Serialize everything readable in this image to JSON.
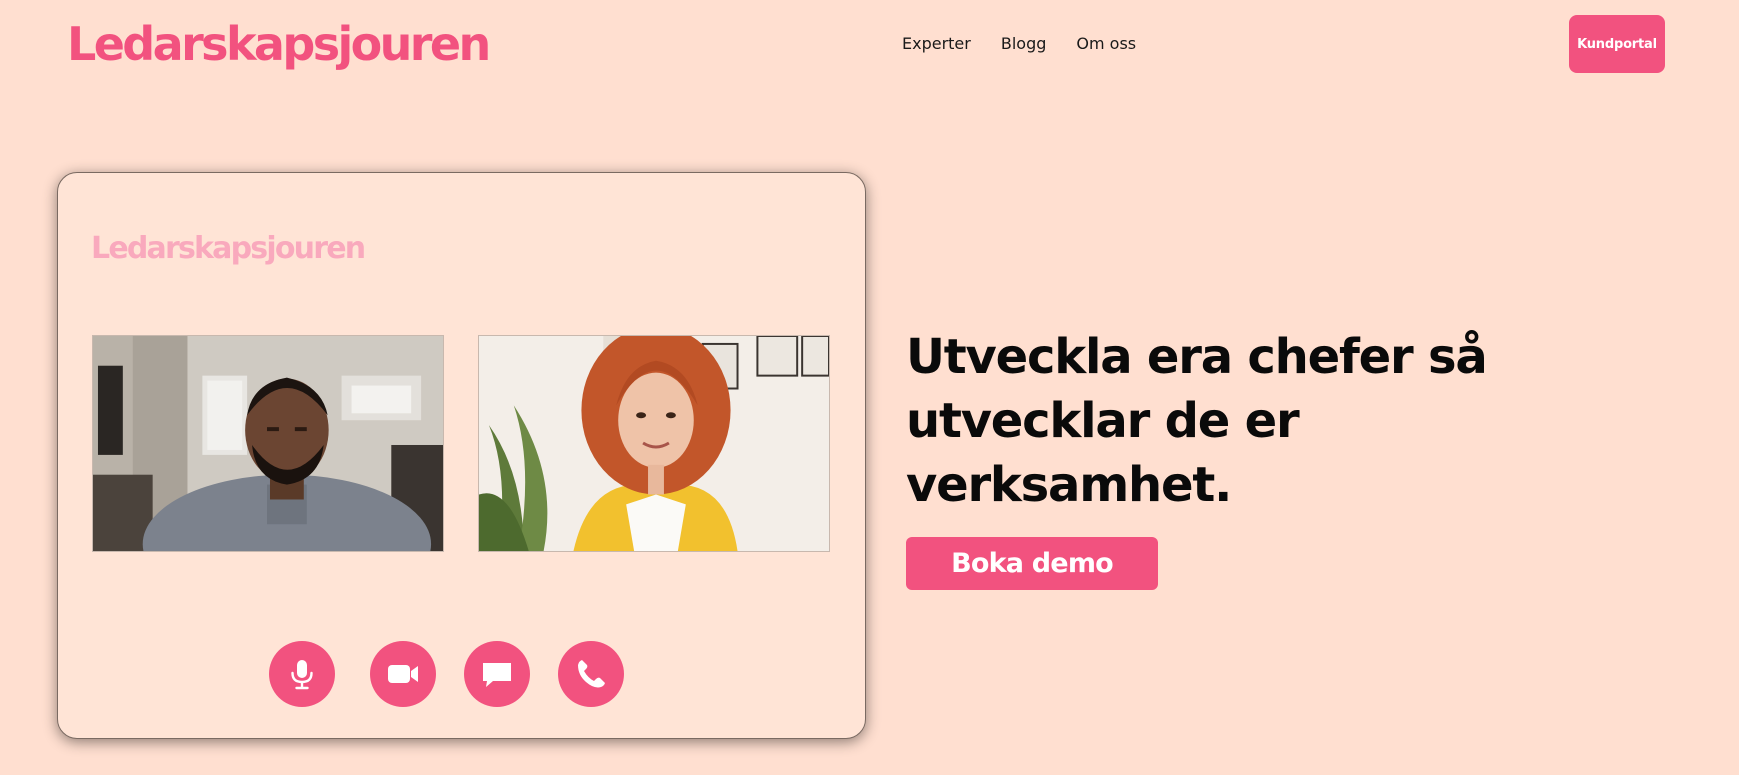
{
  "header": {
    "logo_text": "Ledarskapsjouren",
    "nav": [
      {
        "label": "Experter"
      },
      {
        "label": "Blogg"
      },
      {
        "label": "Om oss"
      }
    ],
    "portal_button": "Kundportal"
  },
  "video_call": {
    "logo_text": "Ledarskapsjouren",
    "controls": [
      {
        "icon": "microphone-icon"
      },
      {
        "icon": "video-camera-icon"
      },
      {
        "icon": "chat-icon"
      },
      {
        "icon": "phone-icon"
      }
    ]
  },
  "hero": {
    "headline": "Utveckla era chefer så utvecklar de er verksamhet.",
    "cta_button": "Boka demo"
  },
  "colors": {
    "background": "#FFDFD0",
    "brand_pink": "#F2527F",
    "card_background": "#FFE4D6",
    "card_logo_pink": "#F9A9BD"
  }
}
